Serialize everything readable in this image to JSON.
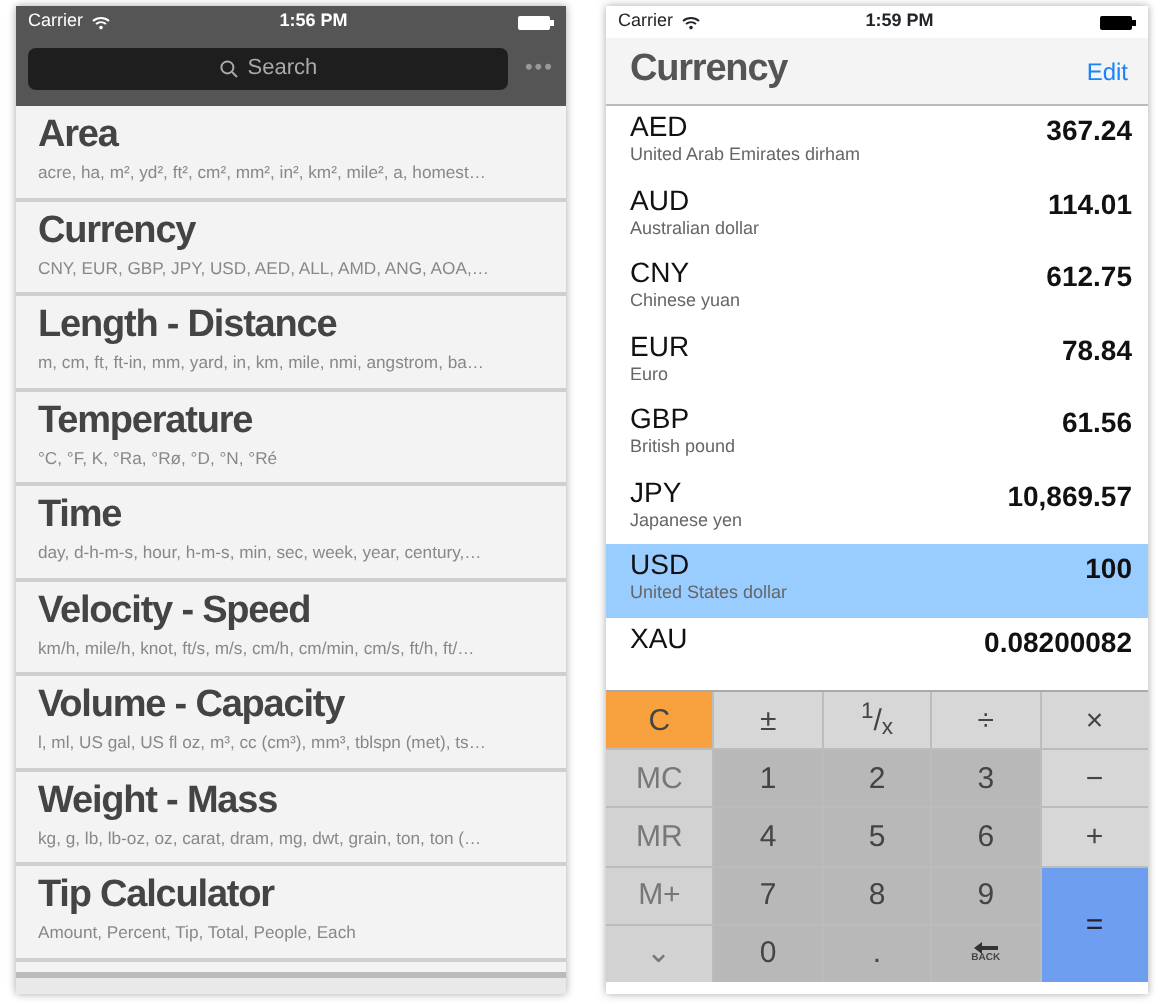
{
  "left_screen": {
    "status_bar": {
      "carrier": "Carrier",
      "time": "1:56 PM"
    },
    "search": {
      "placeholder": "Search"
    },
    "more_button": "•••",
    "categories": [
      {
        "title": "Area",
        "units": "acre, ha, m², yd², ft², cm², mm², in², km², mile², a, homest…"
      },
      {
        "title": "Currency",
        "units": "CNY, EUR, GBP, JPY, USD, AED, ALL, AMD, ANG, AOA,…"
      },
      {
        "title": "Length - Distance",
        "units": "m, cm, ft, ft-in, mm, yard, in, km, mile, nmi, angstrom, ba…"
      },
      {
        "title": "Temperature",
        "units": "°C, °F, K, °Ra, °Rø, °D, °N, °Ré"
      },
      {
        "title": "Time",
        "units": "day, d-h-m-s, hour, h-m-s, min, sec, week, year, century,…"
      },
      {
        "title": "Velocity - Speed",
        "units": "km/h, mile/h, knot, ft/s, m/s, cm/h, cm/min, cm/s, ft/h, ft/…"
      },
      {
        "title": "Volume - Capacity",
        "units": "l, ml, US gal, US fl oz, m³, cc (cm³), mm³, tblspn (met), ts…"
      },
      {
        "title": "Weight - Mass",
        "units": "kg, g, lb, lb-oz, oz, carat, dram, mg, dwt, grain, ton, ton (…"
      },
      {
        "title": "Tip Calculator",
        "units": "Amount, Percent, Tip, Total, People, Each"
      }
    ]
  },
  "right_screen": {
    "status_bar": {
      "carrier": "Carrier",
      "time": "1:59 PM"
    },
    "title": "Currency",
    "edit_button": "Edit",
    "currencies": [
      {
        "code": "AED",
        "name": "United Arab Emirates dirham",
        "value": "367.24",
        "selected": false
      },
      {
        "code": "AUD",
        "name": "Australian dollar",
        "value": "114.01",
        "selected": false
      },
      {
        "code": "CNY",
        "name": "Chinese yuan",
        "value": "612.75",
        "selected": false
      },
      {
        "code": "EUR",
        "name": "Euro",
        "value": "78.84",
        "selected": false
      },
      {
        "code": "GBP",
        "name": "British pound",
        "value": "61.56",
        "selected": false
      },
      {
        "code": "JPY",
        "name": "Japanese yen",
        "value": "10,869.57",
        "selected": false
      },
      {
        "code": "USD",
        "name": "United States dollar",
        "value": "100",
        "selected": true
      },
      {
        "code": "XAU",
        "value": "0.08200082",
        "selected": false
      }
    ],
    "keypad": [
      {
        "label": "C",
        "kind": "clear"
      },
      {
        "label": "±",
        "kind": "op"
      },
      {
        "label": "$^{1}$/$_{x}$",
        "kind": "op"
      },
      {
        "label": "÷",
        "kind": "op"
      },
      {
        "label": "×",
        "kind": "op"
      },
      {
        "label": "MC",
        "kind": "memory"
      },
      {
        "label": "1",
        "kind": "digit"
      },
      {
        "label": "2",
        "kind": "digit"
      },
      {
        "label": "3",
        "kind": "digit"
      },
      {
        "label": "−",
        "kind": "op"
      },
      {
        "label": "MR",
        "kind": "memory"
      },
      {
        "label": "4",
        "kind": "digit"
      },
      {
        "label": "5",
        "kind": "digit"
      },
      {
        "label": "6",
        "kind": "digit"
      },
      {
        "label": "+",
        "kind": "op"
      },
      {
        "label": "M+",
        "kind": "memory"
      },
      {
        "label": "7",
        "kind": "digit"
      },
      {
        "label": "8",
        "kind": "digit"
      },
      {
        "label": "9",
        "kind": "digit"
      },
      {
        "label": "=",
        "kind": "equals"
      },
      {
        "label": "⌄",
        "kind": "memory"
      },
      {
        "label": "0",
        "kind": "digit"
      },
      {
        "label": ".",
        "kind": "digit"
      },
      {
        "label": "BACK",
        "kind": "back"
      }
    ]
  }
}
